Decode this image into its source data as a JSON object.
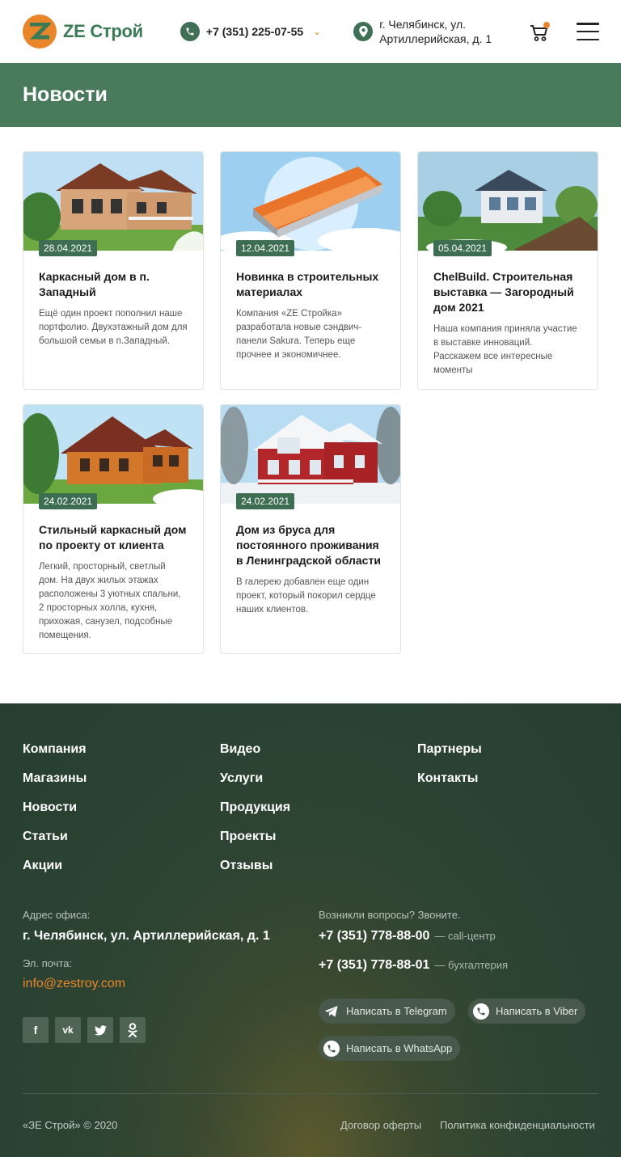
{
  "header": {
    "logo_text": "ZE Строй",
    "phone": "+7 (351) 225-07-55",
    "address": "г. Челябинск, ул. Артиллерийская, д. 1"
  },
  "page_title": "Новости",
  "news": [
    {
      "date": "28.04.2021",
      "title": "Каркасный дом в п. Западный",
      "desc": "Ещё один проект пополнил наше портфолио. Двухэтажный дом для большой семьи в п.Западный."
    },
    {
      "date": "12.04.2021",
      "title": "Новинка в строительных материалах",
      "desc": "Компания «ZE Стройка» разработала новые сэндвич-панели Sakura. Теперь еще прочнее и экономичнее."
    },
    {
      "date": "05.04.2021",
      "title": "ChelBuild. Строительная выставка — Загородный дом 2021",
      "desc": "Наша компания приняла участие в выставке инноваций. Расскажем все интересные моменты"
    },
    {
      "date": "24.02.2021",
      "title": "Стильный каркасный дом по проекту от клиента",
      "desc": "Легкий, просторный, светлый дом. На двух жилых этажах расположены 3 уютных спальни, 2 просторных холла, кухня, прихожая, санузел, подсобные помещения."
    },
    {
      "date": "24.02.2021",
      "title": "Дом из бруса для постоянного проживания в Ленинградской области",
      "desc": "В галерею добавлен еще один проект, который покорил сердце наших клиентов."
    }
  ],
  "footer": {
    "menu": {
      "col1": [
        "Компания",
        "Магазины",
        "Новости",
        "Статьи",
        "Акции"
      ],
      "col2": [
        "Видео",
        "Услуги",
        "Продукция",
        "Проекты",
        "Отзывы"
      ],
      "col3": [
        "Партнеры",
        "Контакты"
      ]
    },
    "office_label": "Адрес офиса:",
    "office_value": "г. Челябинск, ул. Артиллерийская, д. 1",
    "email_label": "Эл. почта:",
    "email_value": "info@zestroy.com",
    "socials": [
      "facebook-icon",
      "vk-icon",
      "twitter-icon",
      "odnoklassniki-icon"
    ],
    "questions_label": "Возникли вопросы? Звоните.",
    "phone1": "+7 (351) 778-88-00",
    "phone1_note": "— call-центр",
    "phone2": "+7 (351) 778-88-01",
    "phone2_note": "— бухгалтерия",
    "telegram": "Написать в Telegram",
    "viber": "Написать в Viber",
    "whatsapp": "Написать в WhatsApp",
    "copyright": "«ЗЕ Строй» © 2020",
    "offer": "Договор оферты",
    "privacy": "Политика конфиденциальности"
  },
  "colors": {
    "brand_green": "#4a7a5c",
    "accent_orange": "#e9862b",
    "footer_bg": "#2e4433"
  }
}
